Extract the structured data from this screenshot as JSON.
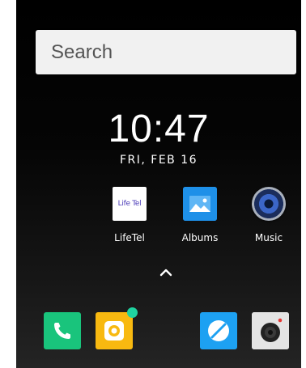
{
  "search": {
    "placeholder": "Search"
  },
  "clock": {
    "time": "10:47",
    "date": "FRI, FEB 16"
  },
  "apps": [
    {
      "label": "LifeTel",
      "icon_text": "Life Tel",
      "icon": "lifetel-icon"
    },
    {
      "label": "Albums",
      "icon": "albums-icon"
    },
    {
      "label": "Music",
      "icon": "music-icon"
    }
  ],
  "drawer": {
    "icon": "chevron-up-icon"
  },
  "dock": [
    {
      "icon": "phone-icon",
      "color": "#19c47c"
    },
    {
      "icon": "camera-app-icon",
      "color": "#f8b910"
    },
    {
      "icon": "browser-icon",
      "color": "#1da1f2"
    },
    {
      "icon": "camera-icon",
      "color": "#e4e4e4"
    }
  ],
  "colors": {
    "background_top": "#000000",
    "background_bottom": "#242424",
    "search_bg": "#f1f1f1",
    "text": "#ffffff"
  }
}
